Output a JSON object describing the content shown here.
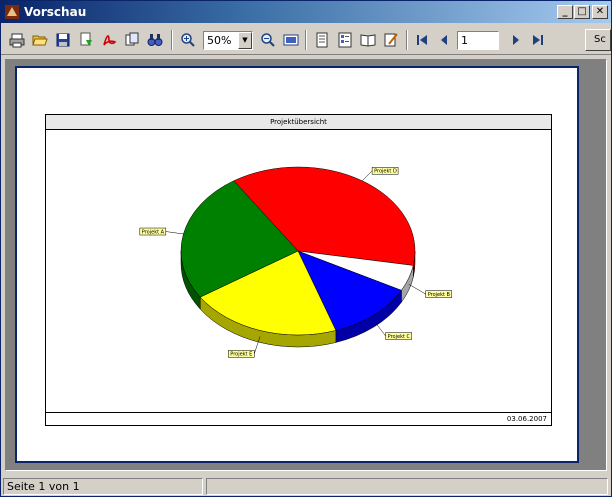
{
  "window": {
    "title": "Vorschau"
  },
  "toolbar": {
    "zoom_value": "50%",
    "page_value": "1",
    "side_button_label": "Sc"
  },
  "report": {
    "title": "Projektübersicht",
    "date": "03.06.2007"
  },
  "chart_data": {
    "type": "pie",
    "title": "Projektübersicht",
    "slices": [
      {
        "label": "Projekt D",
        "value": 37,
        "color": "#ff0000"
      },
      {
        "label": "Projekt B",
        "value": 5,
        "color": "#ffffff"
      },
      {
        "label": "Projekt C",
        "value": 12,
        "color": "#0000ff"
      },
      {
        "label": "Projekt E",
        "value": 21,
        "color": "#ffff00"
      },
      {
        "label": "Projekt A",
        "value": 25,
        "color": "#008000"
      }
    ]
  },
  "status": {
    "page_text": "Seite 1 von 1"
  },
  "colors": {
    "title_bar": "#0a246a",
    "background": "#d4d0c8",
    "preview_bg": "#808080"
  }
}
